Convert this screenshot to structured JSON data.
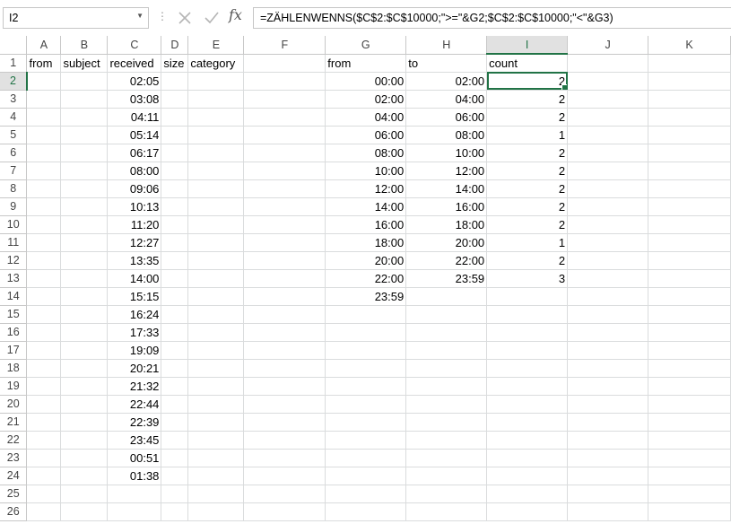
{
  "formula_bar": {
    "name_box": "I2",
    "formula": "=ZÄHLENWENNS($C$2:$C$10000;\">=\"&G2;$C$2:$C$10000;\"<\"&G3)",
    "fx_label": "fx"
  },
  "columns": [
    "A",
    "B",
    "C",
    "D",
    "E",
    "F",
    "G",
    "H",
    "I",
    "J",
    "K"
  ],
  "selected": {
    "column": "I",
    "row": 2
  },
  "rows": [
    {
      "n": "1",
      "cells": {
        "A": "from",
        "B": "subject",
        "C": "received",
        "D": "size",
        "E": "category",
        "G": "from",
        "H": "to",
        "I": "count"
      }
    },
    {
      "n": "2",
      "cells": {
        "C": "02:05",
        "G": "00:00",
        "H": "02:00",
        "I": "2"
      }
    },
    {
      "n": "3",
      "cells": {
        "C": "03:08",
        "G": "02:00",
        "H": "04:00",
        "I": "2"
      }
    },
    {
      "n": "4",
      "cells": {
        "C": "04:11",
        "G": "04:00",
        "H": "06:00",
        "I": "2"
      }
    },
    {
      "n": "5",
      "cells": {
        "C": "05:14",
        "G": "06:00",
        "H": "08:00",
        "I": "1"
      }
    },
    {
      "n": "6",
      "cells": {
        "C": "06:17",
        "G": "08:00",
        "H": "10:00",
        "I": "2"
      }
    },
    {
      "n": "7",
      "cells": {
        "C": "08:00",
        "G": "10:00",
        "H": "12:00",
        "I": "2"
      }
    },
    {
      "n": "8",
      "cells": {
        "C": "09:06",
        "G": "12:00",
        "H": "14:00",
        "I": "2"
      }
    },
    {
      "n": "9",
      "cells": {
        "C": "10:13",
        "G": "14:00",
        "H": "16:00",
        "I": "2"
      }
    },
    {
      "n": "10",
      "cells": {
        "C": "11:20",
        "G": "16:00",
        "H": "18:00",
        "I": "2"
      }
    },
    {
      "n": "11",
      "cells": {
        "C": "12:27",
        "G": "18:00",
        "H": "20:00",
        "I": "1"
      }
    },
    {
      "n": "12",
      "cells": {
        "C": "13:35",
        "G": "20:00",
        "H": "22:00",
        "I": "2"
      }
    },
    {
      "n": "13",
      "cells": {
        "C": "14:00",
        "G": "22:00",
        "H": "23:59",
        "I": "3"
      }
    },
    {
      "n": "14",
      "cells": {
        "C": "15:15",
        "G": "23:59"
      }
    },
    {
      "n": "15",
      "cells": {
        "C": "16:24"
      }
    },
    {
      "n": "16",
      "cells": {
        "C": "17:33"
      }
    },
    {
      "n": "17",
      "cells": {
        "C": "19:09"
      }
    },
    {
      "n": "18",
      "cells": {
        "C": "20:21"
      }
    },
    {
      "n": "19",
      "cells": {
        "C": "21:32"
      }
    },
    {
      "n": "20",
      "cells": {
        "C": "22:44"
      }
    },
    {
      "n": "21",
      "cells": {
        "C": "22:39"
      }
    },
    {
      "n": "22",
      "cells": {
        "C": "23:45"
      }
    },
    {
      "n": "23",
      "cells": {
        "C": "00:51"
      }
    },
    {
      "n": "24",
      "cells": {
        "C": "01:38"
      }
    },
    {
      "n": "25",
      "cells": {}
    },
    {
      "n": "26",
      "cells": {}
    }
  ],
  "colors": {
    "selection": "#217346",
    "gridline": "#dadcdd"
  },
  "icons": {
    "cancel": "close-icon",
    "enter": "checkmark-icon",
    "function": "fx-icon"
  }
}
